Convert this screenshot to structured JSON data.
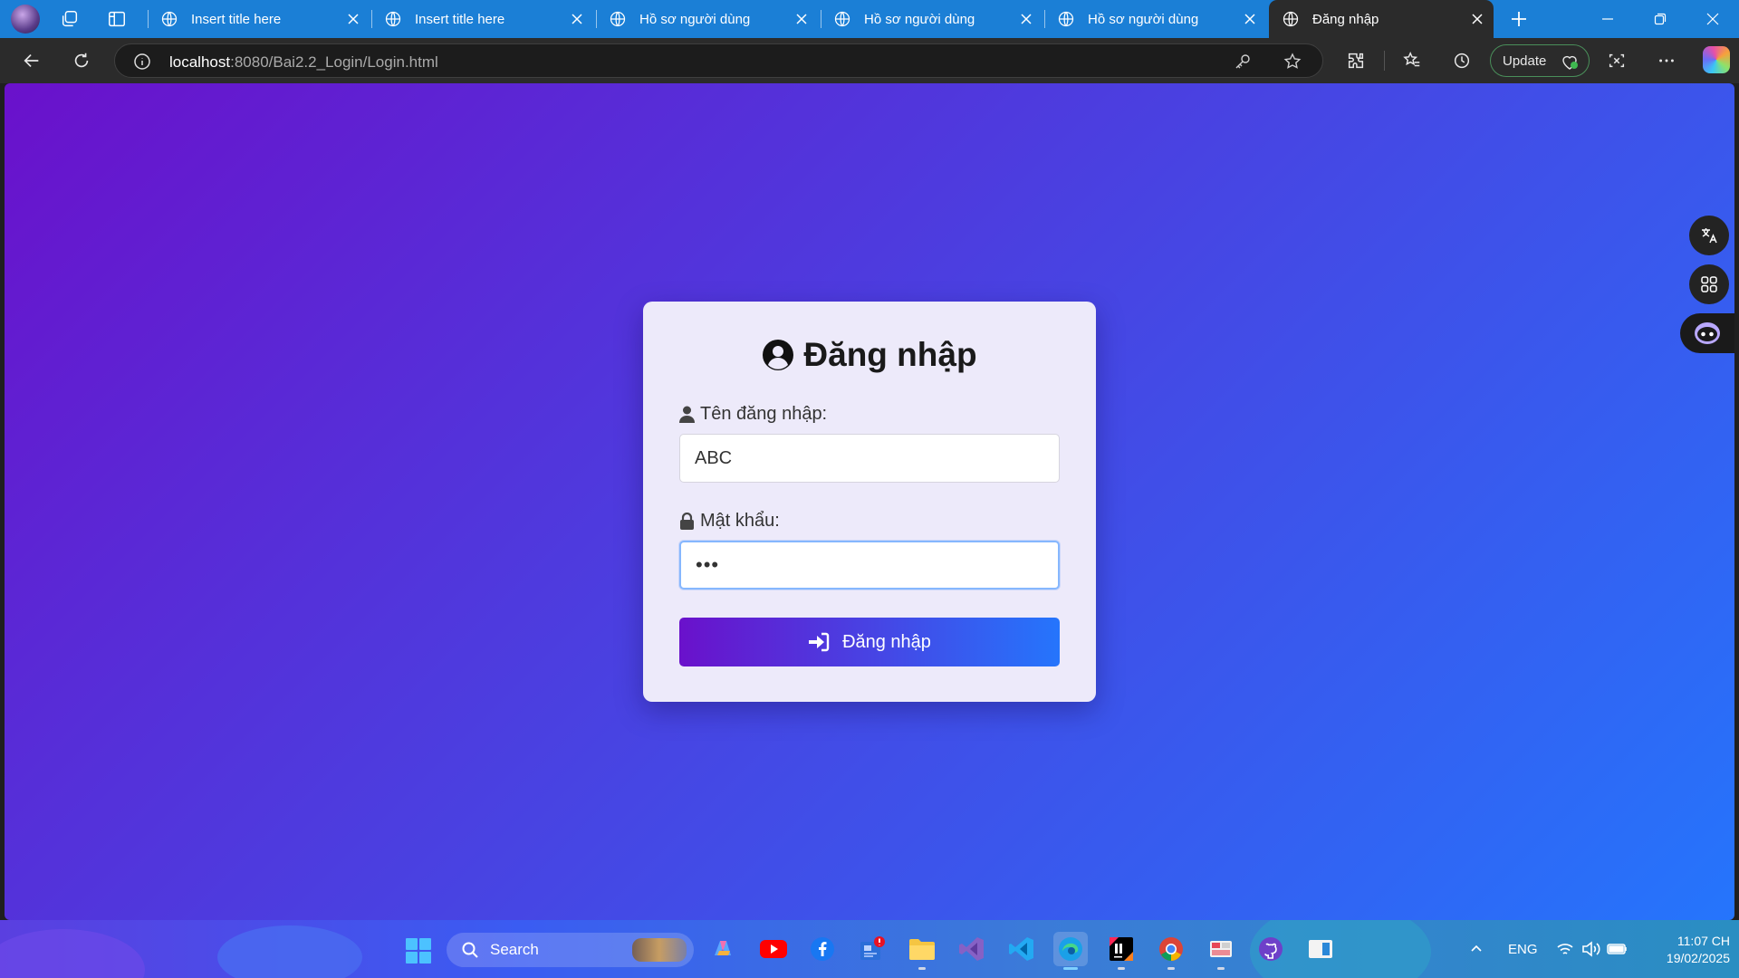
{
  "browser": {
    "tabs": [
      {
        "title": "Insert title here",
        "active": false
      },
      {
        "title": "Insert title here",
        "active": false
      },
      {
        "title": "Hồ sơ người dùng",
        "active": false
      },
      {
        "title": "Hồ sơ người dùng",
        "active": false
      },
      {
        "title": "Hồ sơ người dùng",
        "active": false
      },
      {
        "title": "Đăng nhập",
        "active": true
      }
    ],
    "address": {
      "host": "localhost",
      "path": ":8080/Bai2.2_Login/Login.html"
    },
    "update_label": "Update",
    "colors": {
      "tab_strip": "#1b7fd6",
      "toolbar": "#2b2b2b"
    }
  },
  "login": {
    "title": "Đăng nhập",
    "username_label": "Tên đăng nhập:",
    "username_value": "ABC",
    "password_label": "Mật khẩu:",
    "password_mask": "•••",
    "submit_label": "Đăng nhập",
    "colors": {
      "gradient_start": "#6a11cb",
      "gradient_end": "#2575fc",
      "card_bg": "#edeafa"
    }
  },
  "side_panel": {
    "icons": [
      "translate-icon",
      "apps-icon",
      "assistant-icon"
    ]
  },
  "taskbar": {
    "search_label": "Search",
    "apps": [
      "copilot-app-icon",
      "youtube-icon",
      "facebook-icon",
      "news-icon",
      "file-explorer-icon",
      "visual-studio-icon",
      "vscode-icon",
      "edge-icon",
      "intellij-icon",
      "chrome-icon",
      "snipping-tool-icon",
      "github-icon",
      "tablet-mode-icon"
    ],
    "language": "ENG",
    "time": "11:07 CH",
    "date": "19/02/2025"
  }
}
